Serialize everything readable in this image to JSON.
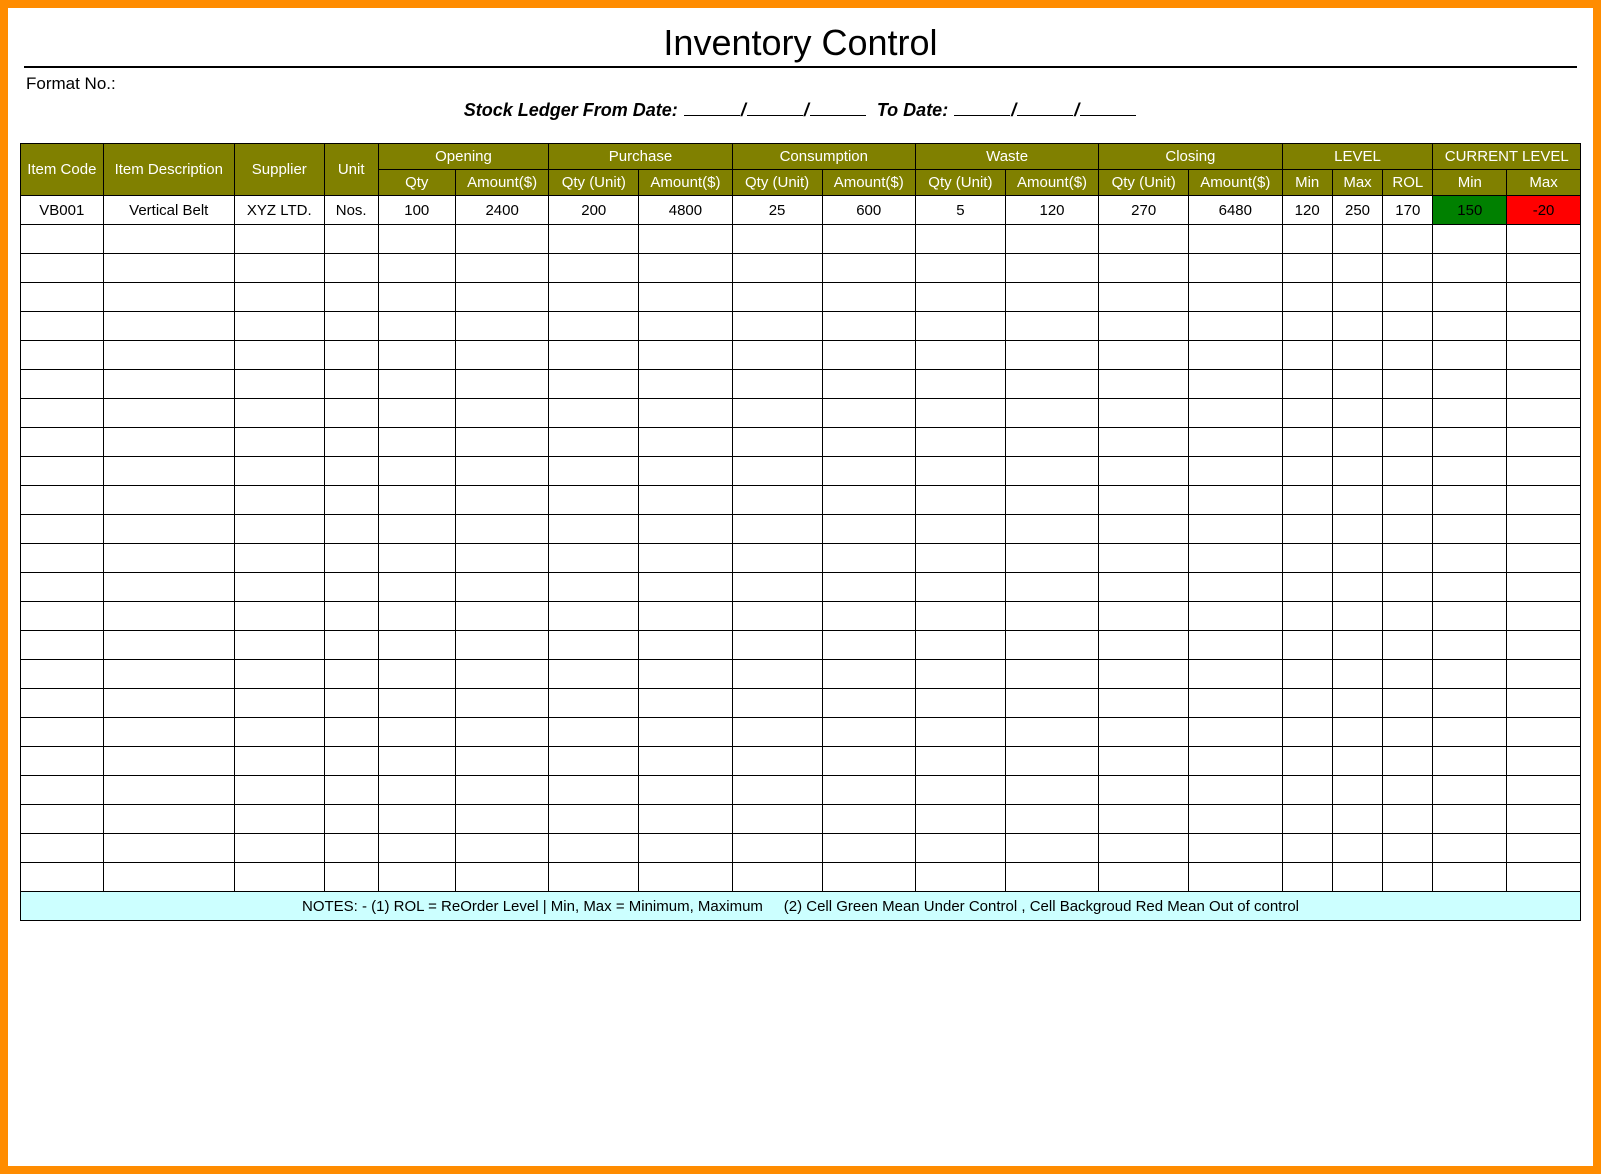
{
  "title": "Inventory Control",
  "format_label": "Format No.:",
  "ledger": {
    "prefix": "Stock Ledger From Date:",
    "to": "To Date:",
    "slash": "/"
  },
  "headers": {
    "item_code": "Item Code",
    "item_desc": "Item Description",
    "supplier": "Supplier",
    "unit": "Unit",
    "opening": "Opening",
    "purchase": "Purchase",
    "consumption": "Consumption",
    "waste": "Waste",
    "closing": "Closing",
    "level": "LEVEL",
    "current_level": "CURRENT LEVEL",
    "qty": "Qty",
    "amount": "Amount($)",
    "qty_unit": "Qty (Unit)",
    "min": "Min",
    "max": "Max",
    "rol": "ROL"
  },
  "rows": [
    {
      "item_code": "VB001",
      "item_desc": "Vertical Belt",
      "supplier": "XYZ LTD.",
      "unit": "Nos.",
      "opening_qty": "100",
      "opening_amt": "2400",
      "purchase_qty": "200",
      "purchase_amt": "4800",
      "consumption_qty": "25",
      "consumption_amt": "600",
      "waste_qty": "5",
      "waste_amt": "120",
      "closing_qty": "270",
      "closing_amt": "6480",
      "level_min": "120",
      "level_max": "250",
      "level_rol": "170",
      "cur_min": "150",
      "cur_max": "-20"
    }
  ],
  "empty_row_count": 23,
  "notes": "NOTES: - (1) ROL = ReOrder Level | Min, Max = Minimum, Maximum     (2) Cell Green Mean Under Control , Cell Backgroud Red Mean Out of control",
  "colors": {
    "header_bg": "#808000",
    "green": "#008000",
    "red": "#ff0000",
    "notes_bg": "#ccffff",
    "page_border": "#ff8c00"
  },
  "colwidths_pct": [
    4.6,
    7.3,
    5.0,
    3.0,
    4.3,
    5.2,
    5.0,
    5.2,
    5.0,
    5.2,
    5.0,
    5.2,
    5.0,
    5.2,
    2.8,
    2.8,
    2.8,
    4.1,
    4.1
  ]
}
